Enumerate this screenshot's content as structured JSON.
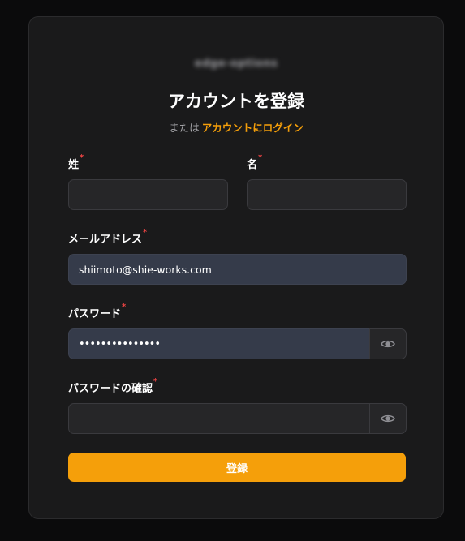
{
  "logo_text": "edge-options",
  "title": "アカウントを登録",
  "subtitle": {
    "prefix": "または",
    "login_link": "アカウントにログイン"
  },
  "form": {
    "required_mark": "*",
    "last_name": {
      "label": "姓",
      "value": ""
    },
    "first_name": {
      "label": "名",
      "value": ""
    },
    "email": {
      "label": "メールアドレス",
      "value": "shiimoto@shie-works.com"
    },
    "password": {
      "label": "パスワード",
      "value": "•••••••••••••••"
    },
    "password_confirm": {
      "label": "パスワードの確認",
      "value": ""
    },
    "submit_label": "登録"
  },
  "colors": {
    "accent": "#f59f0a",
    "required": "#ef4444",
    "card_bg": "#1a1a1b",
    "page_bg": "#0b0b0c"
  },
  "icons": {
    "password_toggle": "eye-icon",
    "password_confirm_toggle": "eye-icon"
  }
}
